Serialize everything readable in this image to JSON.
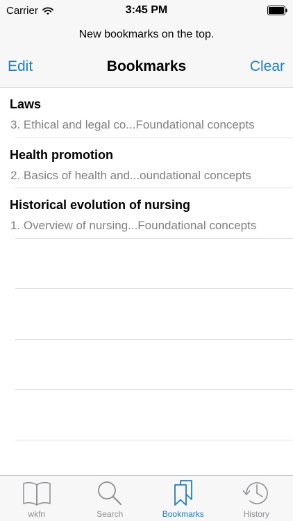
{
  "status_bar": {
    "carrier": "Carrier",
    "time": "3:45 PM"
  },
  "prompt": "New bookmarks on the top.",
  "nav": {
    "left": "Edit",
    "title": "Bookmarks",
    "right": "Clear"
  },
  "bookmarks": [
    {
      "title": "Laws",
      "subtitle": "3. Ethical and legal co...Foundational concepts"
    },
    {
      "title": "Health promotion",
      "subtitle": "2. Basics of health and...oundational concepts"
    },
    {
      "title": "Historical evolution of nursing",
      "subtitle": "1. Overview of nursing...Foundational concepts"
    }
  ],
  "tabs": [
    {
      "label": "wkfn",
      "icon": "book-icon",
      "active": false
    },
    {
      "label": "Search",
      "icon": "magnifier-icon",
      "active": false
    },
    {
      "label": "Bookmarks",
      "icon": "bookmarks-icon",
      "active": true
    },
    {
      "label": "History",
      "icon": "clock-icon",
      "active": false
    }
  ],
  "colors": {
    "accent": "#1a80d4",
    "inactive": "#8e8e93",
    "chrome": "#f7f7f7"
  }
}
